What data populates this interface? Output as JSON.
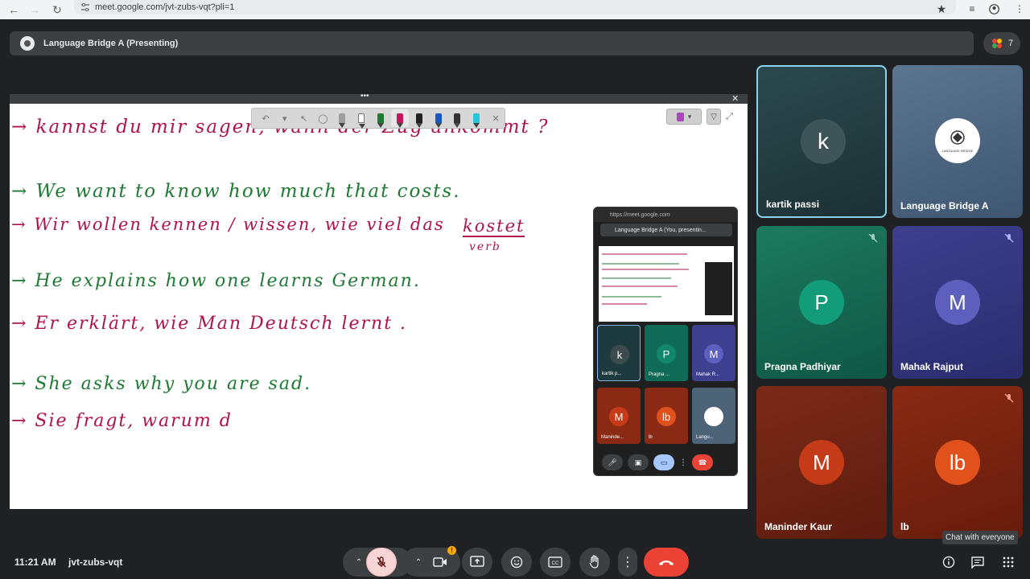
{
  "browser": {
    "url": "meet.google.com/jvt-zubs-vqt?pli=1"
  },
  "header": {
    "presenting_title": "Language Bridge A (Presenting)",
    "people_count": "7"
  },
  "whiteboard": {
    "lines": [
      {
        "text": "→ kannst du mir sagen, wann der Zug ankommt ?",
        "color": "red"
      },
      {
        "text": "→ We want to know how much that costs.",
        "color": "green"
      },
      {
        "text": "→ Wir wollen kennen / wissen, wie viel das",
        "color": "red"
      },
      {
        "text": "kostet",
        "color": "red"
      },
      {
        "text": "verb",
        "color": "red"
      },
      {
        "text": "→ He explains how one learns German.",
        "color": "green"
      },
      {
        "text": "→ Er erklärt, wie Man Deutsch lernt .",
        "color": "red"
      },
      {
        "text": "→ She asks why you are sad.",
        "color": "green"
      },
      {
        "text": "→ Sie fragt, warum d",
        "color": "red"
      }
    ]
  },
  "mini_window": {
    "url": "https://meet.google.com",
    "title": "Language Bridge A (You, presentin...",
    "tiles": [
      {
        "initial": "k",
        "name": "kartik p..."
      },
      {
        "initial": "P",
        "name": "Pragna ..."
      },
      {
        "initial": "M",
        "name": "Mahak R..."
      },
      {
        "initial": "M",
        "name": "Maninde..."
      },
      {
        "initial": "lb",
        "name": "lb"
      },
      {
        "initial": "",
        "name": "Langu..."
      }
    ]
  },
  "participants": [
    {
      "initial": "k",
      "name": "kartik passi",
      "muted": false,
      "active": true
    },
    {
      "initial": "",
      "name": "Language Bridge A",
      "muted": false,
      "logo": "LANGUAGE BRIDGE"
    },
    {
      "initial": "P",
      "name": "Pragna Padhiyar",
      "muted": true
    },
    {
      "initial": "M",
      "name": "Mahak Rajput",
      "muted": true
    },
    {
      "initial": "M",
      "name": "Maninder Kaur",
      "muted": false
    },
    {
      "initial": "lb",
      "name": "lb",
      "muted": true
    }
  ],
  "footer": {
    "time": "11:21 AM",
    "meeting_code": "jvt-zubs-vqt",
    "tooltip": "Chat with everyone"
  },
  "colors": {
    "accent_red": "#ea4335",
    "mic_off_bg": "#f6d5d4",
    "green_tile": "#0f6b55",
    "purple_tile": "#3d3f8f",
    "orange_tile": "#8a2a14"
  },
  "icons": [
    "back-icon",
    "forward-icon",
    "reload-icon",
    "star-icon",
    "mic-off-icon",
    "camera-icon",
    "present-icon",
    "emoji-icon",
    "captions-icon",
    "hand-icon",
    "more-icon",
    "end-call-icon",
    "info-icon",
    "chat-icon",
    "activities-icon"
  ]
}
